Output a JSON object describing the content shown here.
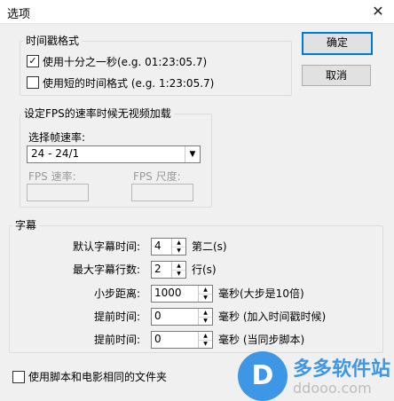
{
  "window": {
    "title": "选项",
    "close_glyph": "✕"
  },
  "buttons": {
    "ok": "确定",
    "cancel": "取消"
  },
  "timestamp_group": {
    "legend": "时间戳格式",
    "opt1": {
      "label": "使用十分之一秒(e.g. 01:23:05.7)",
      "checked": true,
      "mark": "✓"
    },
    "opt2": {
      "label": "使用短的时间格式 (e.g. 1:23:05.7)",
      "checked": false,
      "mark": ""
    }
  },
  "fps_group": {
    "legend": "设定FPS的速率时候无视频加载",
    "select_label": "选择帧速率:",
    "framerate_value": "24  -  24/1",
    "fps_rate_label": "FPS 速率:",
    "fps_scale_label": "FPS 尺度:"
  },
  "subtitle_group": {
    "legend": "字幕",
    "rows": [
      {
        "label": "默认字幕时间:",
        "value": "4",
        "unit": "第二(s)"
      },
      {
        "label": "最大字幕行数:",
        "value": "2",
        "unit": "行(s)"
      },
      {
        "label": "小步距离:",
        "value": "1000",
        "unit": "毫秒(大步是10倍)"
      },
      {
        "label": "提前时间:",
        "value": "0",
        "unit": "毫秒 (加入时间戳时候)"
      },
      {
        "label": "提前时间:",
        "value": "0",
        "unit": "毫秒 (当同步脚本)"
      }
    ]
  },
  "bottom_option": {
    "label": "使用脚本和电影相同的文件夹",
    "checked": false,
    "mark": ""
  },
  "watermark": {
    "logo_letter": "D",
    "brand": "多多软件站",
    "url": "ddooo.com"
  }
}
